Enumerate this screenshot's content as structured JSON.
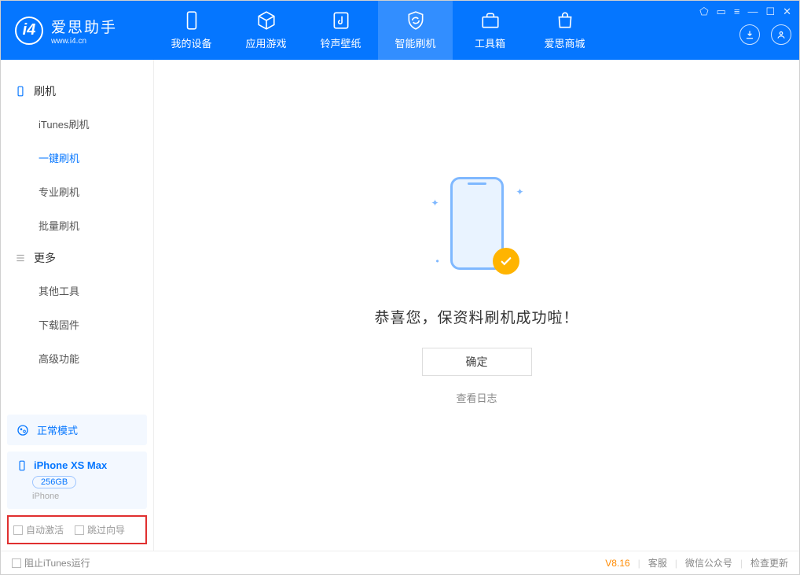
{
  "app": {
    "name": "爱思助手",
    "domain": "www.i4.cn"
  },
  "nav": {
    "tabs": [
      {
        "label": "我的设备"
      },
      {
        "label": "应用游戏"
      },
      {
        "label": "铃声壁纸"
      },
      {
        "label": "智能刷机"
      },
      {
        "label": "工具箱"
      },
      {
        "label": "爱思商城"
      }
    ]
  },
  "sidebar": {
    "section1_title": "刷机",
    "items1": [
      {
        "label": "iTunes刷机"
      },
      {
        "label": "一键刷机"
      },
      {
        "label": "专业刷机"
      },
      {
        "label": "批量刷机"
      }
    ],
    "section2_title": "更多",
    "items2": [
      {
        "label": "其他工具"
      },
      {
        "label": "下载固件"
      },
      {
        "label": "高级功能"
      }
    ],
    "mode_label": "正常模式",
    "device": {
      "name": "iPhone XS Max",
      "storage": "256GB",
      "type": "iPhone"
    },
    "checkbox1": "自动激活",
    "checkbox2": "跳过向导"
  },
  "main": {
    "success_text": "恭喜您，保资料刷机成功啦！",
    "confirm_label": "确定",
    "log_link": "查看日志"
  },
  "footer": {
    "prevent_itunes": "阻止iTunes运行",
    "version": "V8.16",
    "links": [
      {
        "label": "客服"
      },
      {
        "label": "微信公众号"
      },
      {
        "label": "检查更新"
      }
    ]
  }
}
